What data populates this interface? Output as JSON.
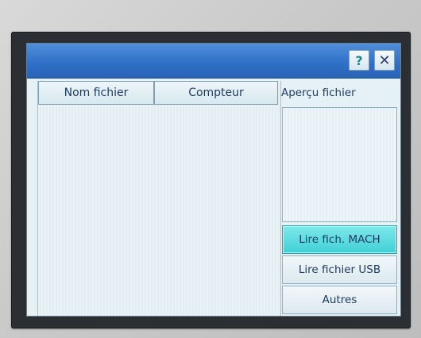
{
  "window": {
    "help_label": "?",
    "close_label": "✕"
  },
  "table": {
    "columns": [
      "Nom fichier",
      "Compteur"
    ],
    "rows": []
  },
  "preview": {
    "label": "Aperçu fichier"
  },
  "buttons": {
    "read_machine": "Lire fich. MACH",
    "read_usb": "Lire fichier USB",
    "others": "Autres"
  },
  "colors": {
    "titlebar": "#2f6fc6",
    "active_button": "#3fd0d6",
    "text": "#1e3c63"
  }
}
